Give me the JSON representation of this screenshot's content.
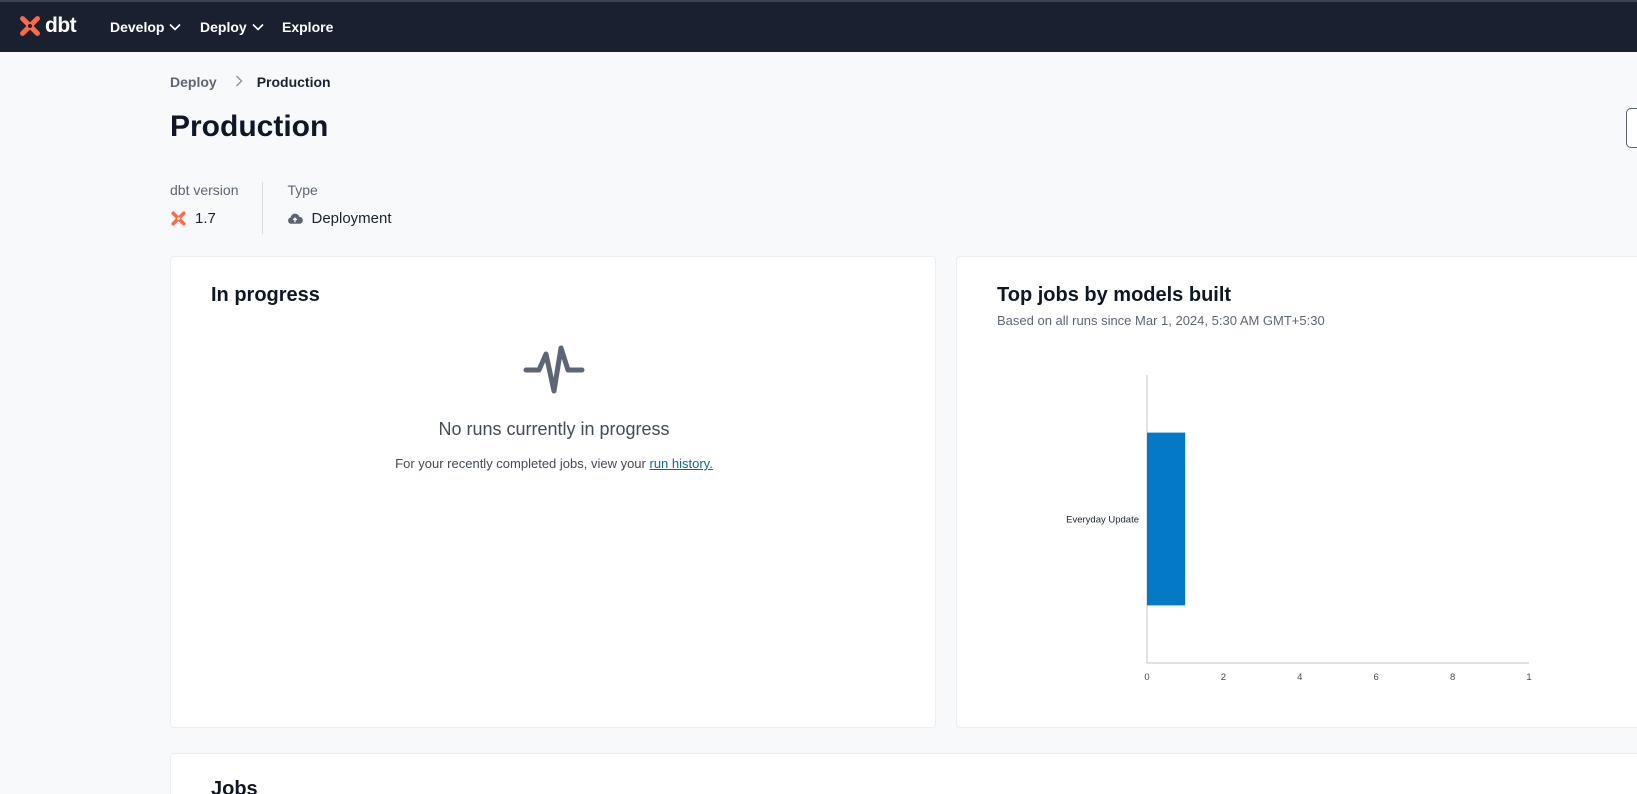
{
  "nav": {
    "brand": "dbt",
    "items": [
      {
        "label": "Develop",
        "has_dropdown": true
      },
      {
        "label": "Deploy",
        "has_dropdown": true
      },
      {
        "label": "Explore",
        "has_dropdown": false
      }
    ]
  },
  "breadcrumb": {
    "root": "Deploy",
    "current": "Production"
  },
  "page": {
    "title": "Production"
  },
  "meta": {
    "version_label": "dbt version",
    "version_value": "1.7",
    "type_label": "Type",
    "type_value": "Deployment"
  },
  "in_progress": {
    "title": "In progress",
    "empty_title": "No runs currently in progress",
    "empty_text": "For your recently completed jobs, view your ",
    "link_text": "run history."
  },
  "top_jobs": {
    "title": "Top jobs by models built",
    "subtitle": "Based on all runs since Mar 1, 2024, 5:30 AM GMT+5:30"
  },
  "jobs": {
    "title": "Jobs"
  },
  "colors": {
    "brand": "#ff694a",
    "nav_bg": "#192130",
    "bar": "#047ac6",
    "link": "#0d6d88"
  },
  "chart_data": {
    "type": "bar",
    "orientation": "horizontal",
    "categories": [
      "Everyday Update"
    ],
    "values": [
      1
    ],
    "x_ticks": [
      "0",
      "2",
      "4",
      "6",
      "8",
      "1"
    ],
    "xlim": [
      0,
      10
    ],
    "grid": false
  }
}
